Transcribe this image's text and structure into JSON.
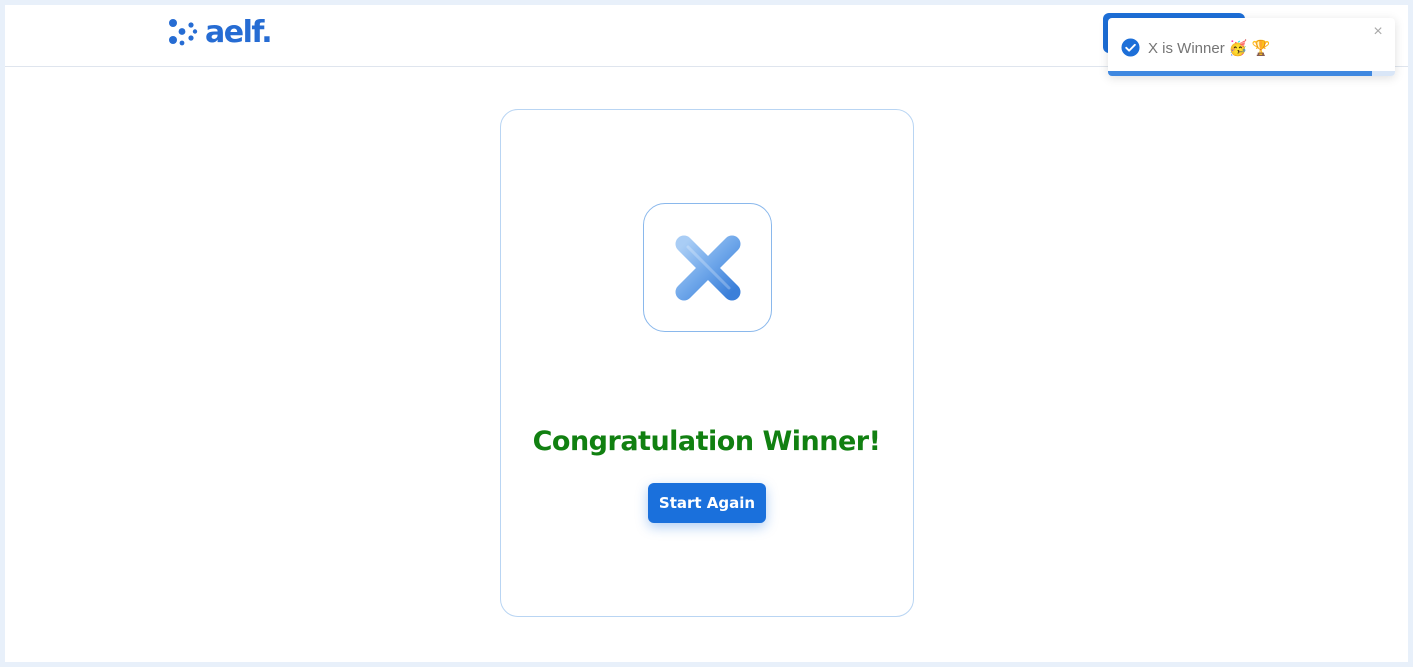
{
  "header": {
    "logo_text": "aelf.",
    "brand_color": "#266cd3",
    "action_button_color": "#1d6fd8"
  },
  "game": {
    "winner_mark": "X",
    "winner_mark_icon": "x-mark-icon",
    "title": "Congratulation Winner!",
    "title_color": "#118011",
    "start_again_label": "Start Again",
    "button_color": "#1a70dc"
  },
  "toast": {
    "message": "X is Winner 🥳 🏆",
    "icon": "check-circle-icon",
    "close_icon": "close-icon",
    "close_glyph": "×",
    "progress": 0.92,
    "progress_color": "#3f88e0"
  }
}
